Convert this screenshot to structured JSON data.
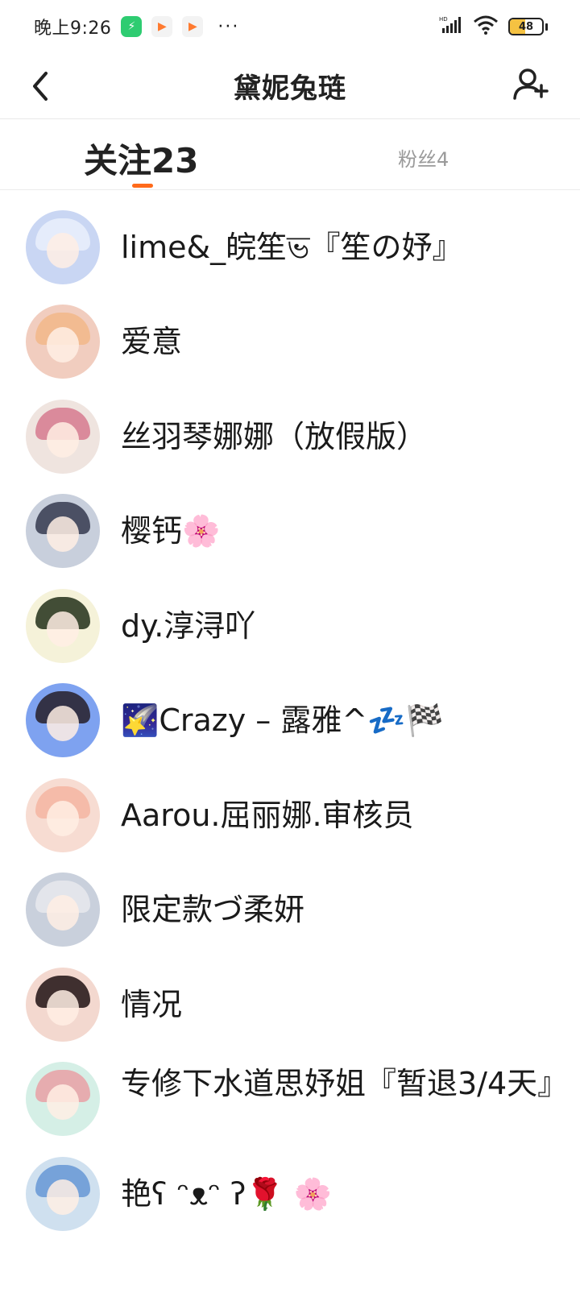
{
  "status_bar": {
    "time": "晚上9:26",
    "apps": [
      "green-app-icon",
      "video-play-icon",
      "video-play-icon"
    ],
    "more": "···",
    "network": "HD",
    "battery": "48"
  },
  "header": {
    "title": "黛妮兔琏"
  },
  "tabs": {
    "following": "关注23",
    "fans": "粉丝4"
  },
  "following_list": [
    {
      "name": "lime&_皖笙ভ『笙の妤』",
      "avatar_color": "#c9d6f3",
      "hair": "#e8eefc"
    },
    {
      "name": "爱意",
      "avatar_color": "#f1cdbf",
      "hair": "#f2b98c"
    },
    {
      "name": "丝羽琴娜娜（放假版）",
      "avatar_color": "#efe4df",
      "hair": "#d77f94"
    },
    {
      "name": "樱钙🌸",
      "avatar_color": "#c8cfdc",
      "hair": "#3d4157"
    },
    {
      "name": "dy.淳浔吖",
      "avatar_color": "#f5f2d9",
      "hair": "#2f3b23"
    },
    {
      "name": "🌠Crazy – 露雅^💤🏁",
      "avatar_color": "#7ea2f0",
      "hair": "#2b2633"
    },
    {
      "name": "Aarou.屈丽娜.审核员",
      "avatar_color": "#f7dcd2",
      "hair": "#f4b7a4"
    },
    {
      "name": "限定款づ柔妍",
      "avatar_color": "#c9d0dc",
      "hair": "#e5e7ec"
    },
    {
      "name": "情况",
      "avatar_color": "#f3d8cf",
      "hair": "#2b1d1d"
    },
    {
      "name": "专修下水道思妤姐『暂退3/4天』",
      "avatar_color": "#d5efe6",
      "hair": "#e8a4a9"
    },
    {
      "name": "艳ʕ ᵔᴥᵔ ʔ🌹 🌸",
      "avatar_color": "#cfe0ef",
      "hair": "#6b9bd6"
    }
  ],
  "colors": {
    "accent": "#ff6a1a",
    "muted_text": "#9a9a9a"
  }
}
